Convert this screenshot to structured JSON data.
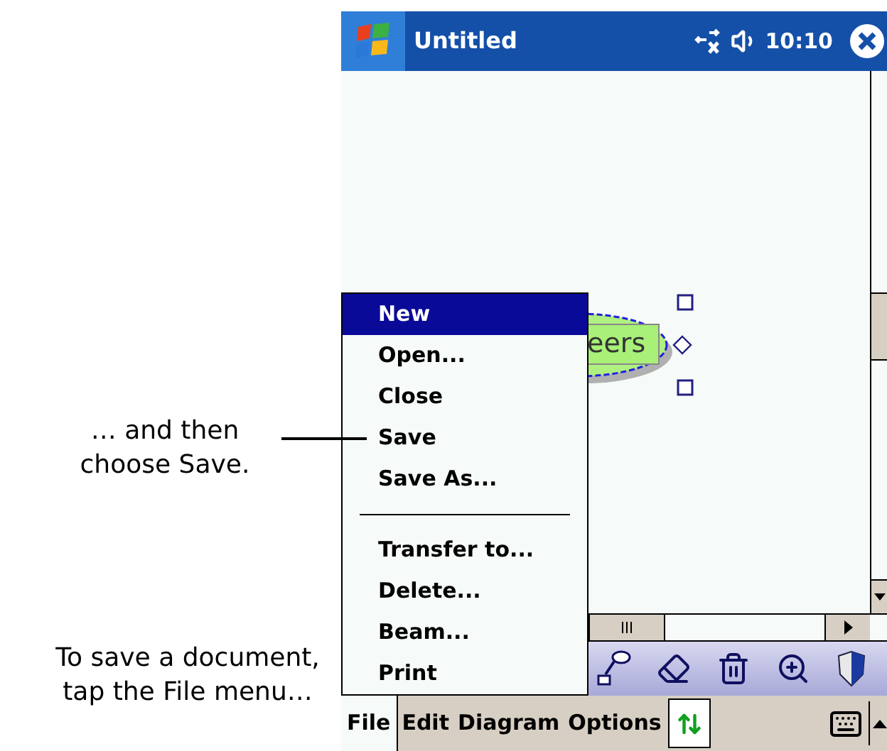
{
  "annotations": [
    {
      "text": "… and then choose Save."
    },
    {
      "text": "To save a document, tap the File menu…"
    }
  ],
  "title_bar": {
    "title": "Untitled",
    "time": "10:10"
  },
  "diagram": {
    "label": "eers"
  },
  "file_menu": {
    "items": [
      {
        "kind": "item",
        "label": "New",
        "selected": true
      },
      {
        "kind": "item",
        "label": "Open...",
        "selected": false
      },
      {
        "kind": "item",
        "label": "Close",
        "selected": false
      },
      {
        "kind": "item",
        "label": "Save",
        "selected": false
      },
      {
        "kind": "item",
        "label": "Save As...",
        "selected": false
      },
      {
        "kind": "separator"
      },
      {
        "kind": "item",
        "label": "Transfer to...",
        "selected": false
      },
      {
        "kind": "item",
        "label": "Delete...",
        "selected": false
      },
      {
        "kind": "item",
        "label": "Beam...",
        "selected": false
      },
      {
        "kind": "item",
        "label": "Print",
        "selected": false
      }
    ]
  },
  "menu_bar": {
    "items": [
      {
        "label": "File",
        "selected": true
      },
      {
        "label": "Edit",
        "selected": false
      },
      {
        "label": "Diagram",
        "selected": false
      },
      {
        "label": "Options",
        "selected": false
      }
    ]
  }
}
